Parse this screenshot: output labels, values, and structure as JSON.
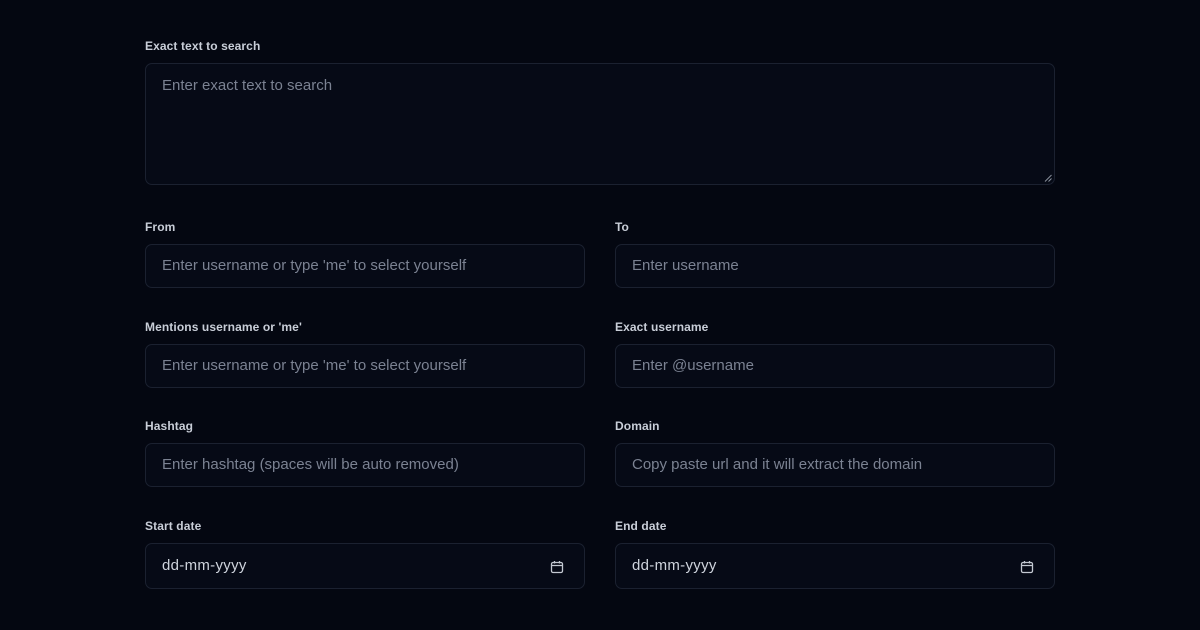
{
  "form": {
    "exact_text": {
      "label": "Exact text to search",
      "placeholder": "Enter exact text to search"
    },
    "from": {
      "label": "From",
      "placeholder": "Enter username or type 'me' to select yourself"
    },
    "to": {
      "label": "To",
      "placeholder": "Enter username"
    },
    "mentions": {
      "label": "Mentions username or 'me'",
      "placeholder": "Enter username or type 'me' to select yourself"
    },
    "exact_username": {
      "label": "Exact username",
      "placeholder": "Enter @username"
    },
    "hashtag": {
      "label": "Hashtag",
      "placeholder": "Enter hashtag (spaces will be auto removed)"
    },
    "domain": {
      "label": "Domain",
      "placeholder": "Copy paste url and it will extract the domain"
    },
    "start_date": {
      "label": "Start date",
      "value": "dd-mm-yyyy",
      "icon": "calendar-icon"
    },
    "end_date": {
      "label": "End date",
      "value": "dd-mm-yyyy",
      "icon": "calendar-icon"
    }
  },
  "colors": {
    "background": "#040711",
    "field_border": "#1b2130",
    "label": "#c9ced8",
    "placeholder": "#7b8292"
  }
}
